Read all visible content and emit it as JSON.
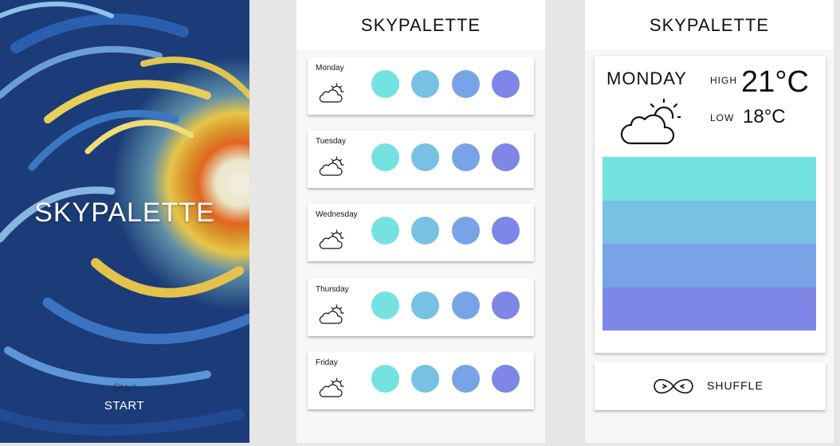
{
  "app_name": "SKYPALETTE",
  "splash": {
    "title": "SKYPALETTE",
    "start_shadow_text": "Start",
    "start_label": "START"
  },
  "list": {
    "title": "SKYPALETTE",
    "weather_icon": "partly-cloudy-icon",
    "days": [
      {
        "name": "Monday"
      },
      {
        "name": "Tuesday"
      },
      {
        "name": "Wednesday"
      },
      {
        "name": "Thursday"
      },
      {
        "name": "Friday"
      }
    ]
  },
  "palette": [
    "#74e2e0",
    "#77c1e4",
    "#78a3e6",
    "#7e86e6"
  ],
  "detail": {
    "title": "SKYPALETTE",
    "day": "MONDAY",
    "high_label": "HIGH",
    "high": "21°C",
    "low_label": "LOW",
    "low": "18°C",
    "weather_icon": "partly-cloudy-icon",
    "shuffle_icon": "infinity-shuffle-icon",
    "shuffle_label": "SHUFFLE"
  }
}
